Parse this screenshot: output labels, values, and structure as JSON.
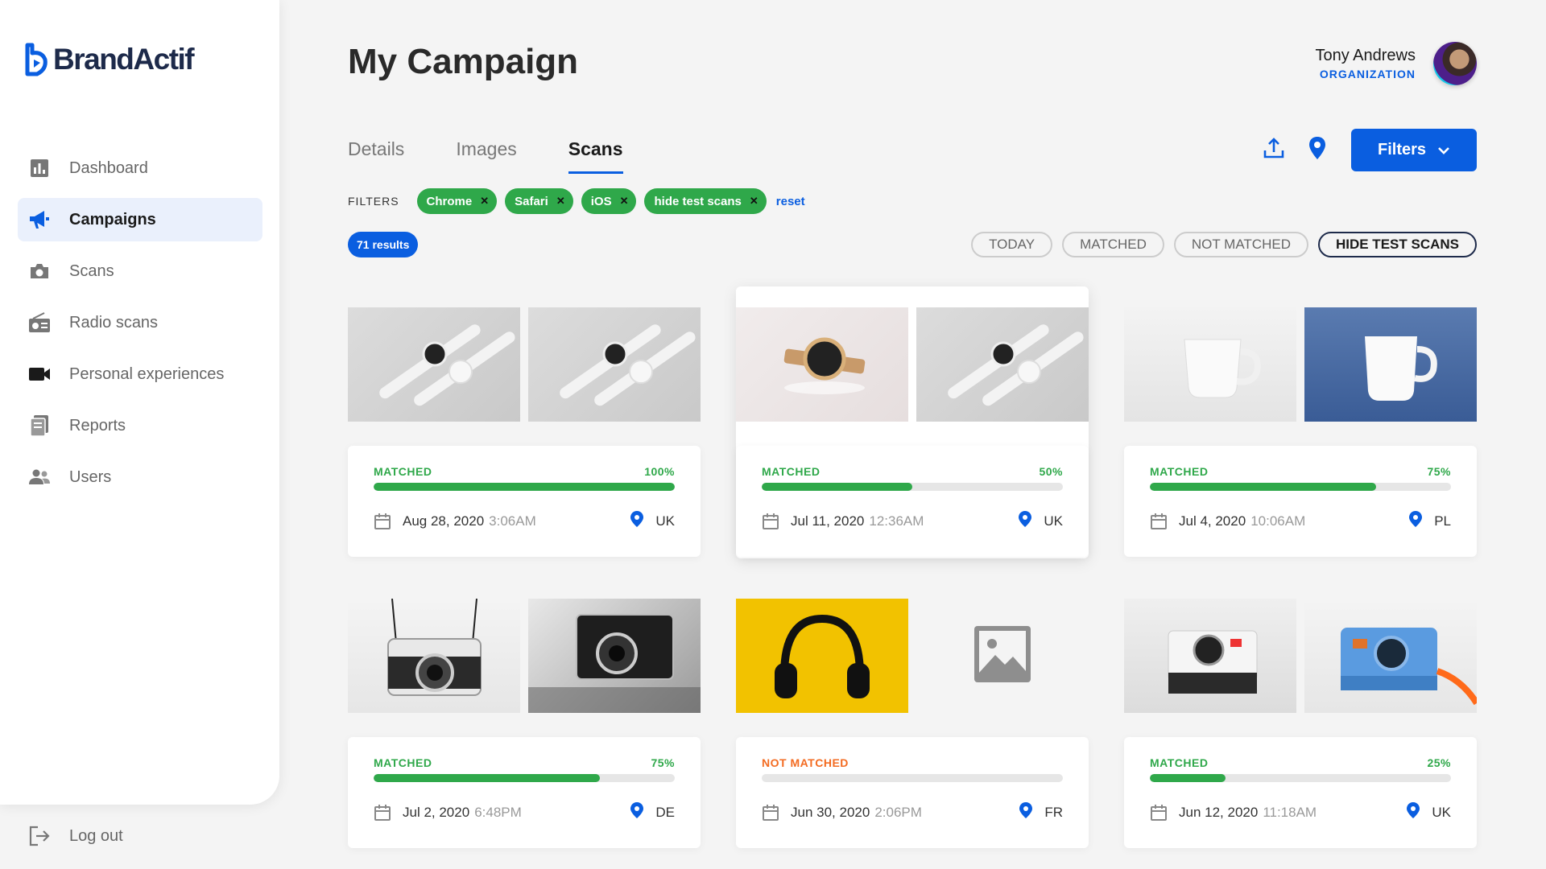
{
  "brand": {
    "name": "BrandActif"
  },
  "sidebar": {
    "items": [
      {
        "label": "Dashboard",
        "icon": "bar-chart-icon",
        "active": false
      },
      {
        "label": "Campaigns",
        "icon": "megaphone-icon",
        "active": true
      },
      {
        "label": "Scans",
        "icon": "camera-icon",
        "active": false
      },
      {
        "label": "Radio scans",
        "icon": "radio-icon",
        "active": false
      },
      {
        "label": "Personal experiences",
        "icon": "video-camera-icon",
        "active": false
      },
      {
        "label": "Reports",
        "icon": "reports-icon",
        "active": false
      },
      {
        "label": "Users",
        "icon": "users-icon",
        "active": false
      }
    ],
    "logout_label": "Log out"
  },
  "header": {
    "title": "My Campaign",
    "user_name": "Tony Andrews",
    "user_org": "ORGANIZATION"
  },
  "tabs": [
    {
      "label": "Details",
      "active": false
    },
    {
      "label": "Images",
      "active": false
    },
    {
      "label": "Scans",
      "active": true
    }
  ],
  "toolbar": {
    "export_icon": "upload-icon",
    "map_icon": "map-pin-icon",
    "filters_label": "Filters"
  },
  "filters": {
    "label": "FILTERS",
    "chips": [
      "Chrome",
      "Safari",
      "iOS",
      "hide test scans"
    ],
    "reset_label": "reset"
  },
  "results_label": "71 results",
  "quick_filters": [
    {
      "label": "TODAY",
      "active": false
    },
    {
      "label": "MATCHED",
      "active": false
    },
    {
      "label": "NOT MATCHED",
      "active": false
    },
    {
      "label": "HIDE TEST SCANS",
      "active": true
    }
  ],
  "colors": {
    "accent": "#0a5ee0",
    "matched": "#2fa84a",
    "not_matched": "#f36b21"
  },
  "scans": [
    {
      "status": "MATCHED",
      "percent_label": "100%",
      "match": 1.0,
      "date": "Aug 28, 2020",
      "time": "3:06AM",
      "country": "UK",
      "images": [
        "watch-pair",
        "watch-pair"
      ]
    },
    {
      "status": "MATCHED",
      "percent_label": "50%",
      "match": 0.5,
      "date": "Jul 11, 2020",
      "time": "12:36AM",
      "country": "UK",
      "images": [
        "wrist-watch",
        "watch-pair"
      ]
    },
    {
      "status": "MATCHED",
      "percent_label": "75%",
      "match": 0.75,
      "date": "Jul 4, 2020",
      "time": "10:06AM",
      "country": "PL",
      "images": [
        "white-mug",
        "white-mug-blue"
      ]
    },
    {
      "status": "MATCHED",
      "percent_label": "75%",
      "match": 0.75,
      "date": "Jul 2, 2020",
      "time": "6:48PM",
      "country": "DE",
      "images": [
        "film-camera",
        "film-camera-bw"
      ]
    },
    {
      "status": "NOT MATCHED",
      "percent_label": "",
      "match": 0,
      "date": "Jun 30, 2020",
      "time": "2:06PM",
      "country": "FR",
      "images": [
        "headphones",
        "image-placeholder"
      ]
    },
    {
      "status": "MATCHED",
      "percent_label": "25%",
      "match": 0.25,
      "date": "Jun 12, 2020",
      "time": "11:18AM",
      "country": "UK",
      "images": [
        "polaroid-camera",
        "polaroid-camera-blue"
      ]
    }
  ]
}
